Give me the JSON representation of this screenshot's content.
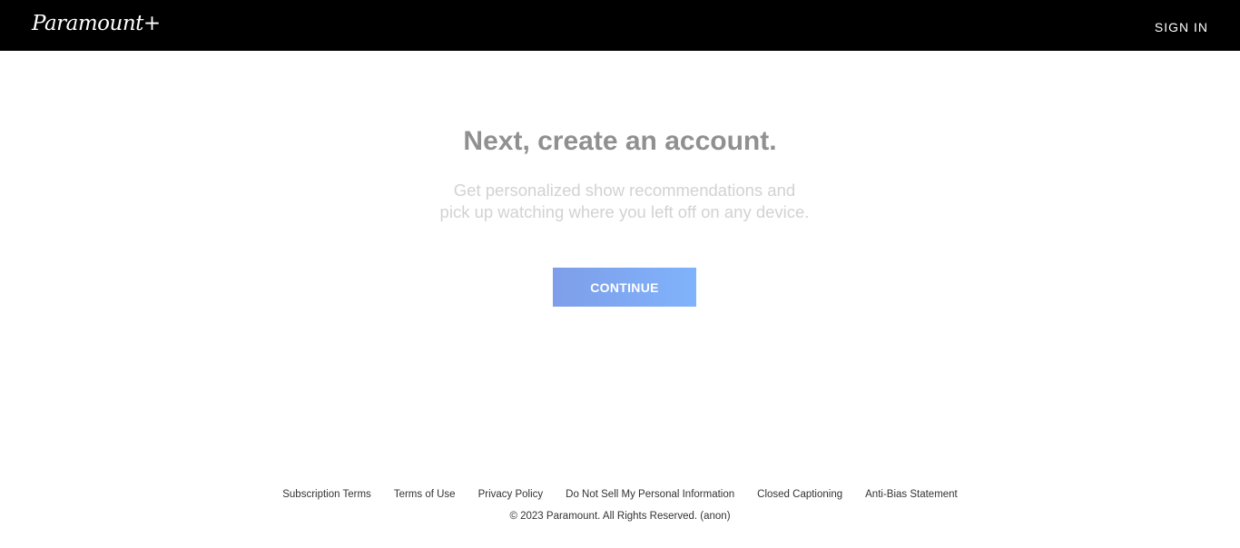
{
  "header": {
    "logo_text": "Paramount+",
    "sign_in_label": "SIGN IN"
  },
  "main": {
    "headline": "Next, create an account.",
    "subtext": "Get personalized show recommendations and pick up watching where you left off on any device.",
    "continue_label": "CONTINUE"
  },
  "footer": {
    "links": [
      "Subscription Terms",
      "Terms of Use",
      "Privacy Policy",
      "Do Not Sell My Personal Information",
      "Closed Captioning",
      "Anti-Bias Statement"
    ],
    "copyright": "© 2023 Paramount. All Rights Reserved. (anon)"
  },
  "colors": {
    "header_bg": "#000000",
    "headline": "#909090",
    "subtext": "#d2d2d2",
    "button_gradient_start": "#7f9ee9",
    "button_gradient_end": "#7fb3fb"
  }
}
